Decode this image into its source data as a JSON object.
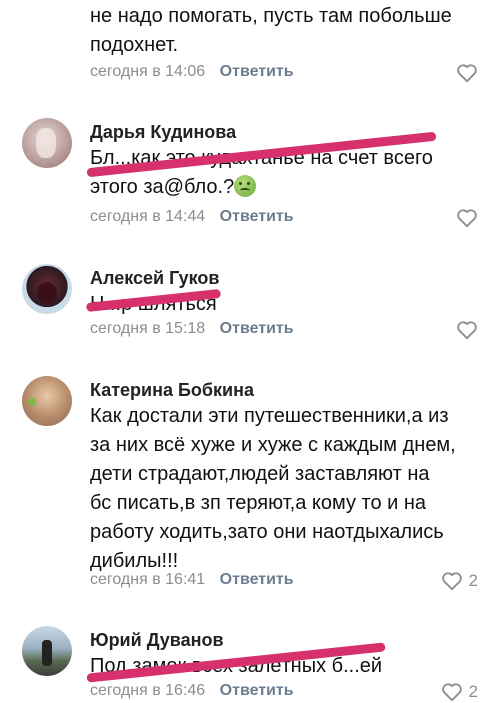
{
  "comments": [
    {
      "author": "",
      "lines": [
        "не надо помогать, пусть там побольше",
        "подохнет."
      ],
      "time": "сегодня в 14:06",
      "reply_label": "Ответить",
      "likes": ""
    },
    {
      "author": "Дарья Кудинова",
      "lines": [
        "Бл...как это кудахтанье на счет всего",
        "этого за@бло.?"
      ],
      "time": "сегодня в 14:44",
      "reply_label": "Ответить",
      "likes": ""
    },
    {
      "author": "Алексей Гуков",
      "lines": [
        "Н...р шляться"
      ],
      "time": "сегодня в 15:18",
      "reply_label": "Ответить",
      "likes": ""
    },
    {
      "author": "Катерина Бобкина",
      "lines": [
        "Как достали эти путешественники,а из",
        "за них всё хуже и хуже с каждым днем,",
        "дети страдают,людей заставляют на",
        "бс писать,в зп теряют,а кому то и на",
        "работу ходить,зато они наотдыхались",
        "дибилы!!!"
      ],
      "time": "сегодня в 16:41",
      "reply_label": "Ответить",
      "likes": "2"
    },
    {
      "author": "Юрий Дуванов",
      "lines": [
        "Под замок всех залётных б...ей"
      ],
      "time": "сегодня в 16:46",
      "reply_label": "Ответить",
      "likes": "2"
    }
  ],
  "icons": {
    "like": "heart-outline-icon",
    "emoji": "nauseated-face-emoji"
  },
  "colors": {
    "meta": "#8a8d92",
    "reply": "#6b7d8f",
    "censor_mark": "#d6306d"
  }
}
